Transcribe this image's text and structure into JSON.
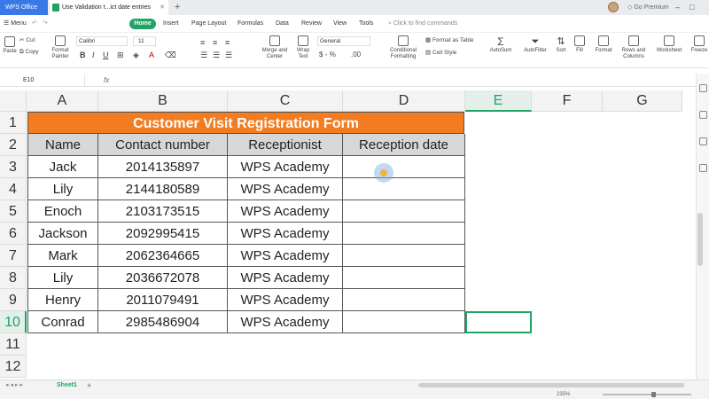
{
  "app_tab": "WPS Office",
  "doc_tab": "Use Validation t...ict date entries",
  "premium": "Go Premium",
  "menu": {
    "menu_label": "Menu",
    "items": [
      "Home",
      "Insert",
      "Page Layout",
      "Formulas",
      "Data",
      "Review",
      "View",
      "Tools"
    ],
    "find_placeholder": "Click to find commands"
  },
  "ribbon": {
    "paste": "Paste",
    "cut": "Cut",
    "copy": "Copy",
    "format_painter": "Format Painter",
    "font_name": "Calibri",
    "font_size": "11",
    "merge_center": "Merge and Center",
    "wrap_text": "Wrap Text",
    "number_format": "General",
    "conditional_formatting": "Conditional Formatting",
    "format_as_table": "Format as Table",
    "cell_style": "Cell Style",
    "autosum": "AutoSum",
    "autofilter": "AutoFilter",
    "sort": "Sort",
    "fill": "Fill",
    "format": "Format",
    "rows_columns": "Rows and Columns",
    "worksheet": "Worksheet",
    "freeze": "Freeze"
  },
  "formula_bar": {
    "cell_ref": "E10",
    "fx": "fx"
  },
  "columns": [
    "A",
    "B",
    "C",
    "D",
    "E",
    "F",
    "G"
  ],
  "active_column": "E",
  "rows": [
    "1",
    "2",
    "3",
    "4",
    "5",
    "6",
    "7",
    "8",
    "9",
    "10",
    "11",
    "12"
  ],
  "active_row": "10",
  "table": {
    "title": "Customer Visit Registration Form",
    "headers": [
      "Name",
      "Contact number",
      "Receptionist",
      "Reception date"
    ],
    "records": [
      [
        "Jack",
        "2014135897",
        "WPS Academy",
        ""
      ],
      [
        "Lily",
        "2144180589",
        "WPS Academy",
        ""
      ],
      [
        "Enoch",
        "2103173515",
        "WPS Academy",
        ""
      ],
      [
        "Jackson",
        "2092995415",
        "WPS Academy",
        ""
      ],
      [
        "Mark",
        "2062364665",
        "WPS Academy",
        ""
      ],
      [
        "Lily",
        "2036672078",
        "WPS Academy",
        ""
      ],
      [
        "Henry",
        "2011079491",
        "WPS Academy",
        ""
      ],
      [
        "Conrad",
        "2985486904",
        "WPS Academy",
        ""
      ]
    ]
  },
  "sheet_tab": "Sheet1",
  "zoom_label": "235%",
  "colors": {
    "accent": "#21a366",
    "title_fill": "#f47c20",
    "header_fill": "#d7d7d7"
  }
}
